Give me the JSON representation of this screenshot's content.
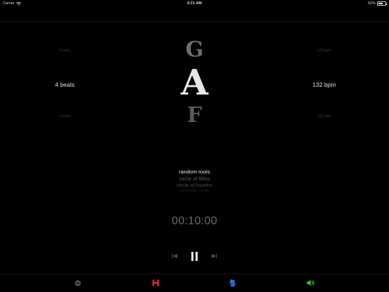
{
  "status": {
    "carrier": "Carrier",
    "time": "9:21 AM",
    "battery_percent": "62%",
    "battery_level": 0.62
  },
  "beats": {
    "above": "3 beats",
    "current": "4 beats",
    "below": "5 beats"
  },
  "tempo": {
    "above": "131 bpm",
    "current": "132 bpm",
    "below": "133 bpm"
  },
  "notes": {
    "previous": "G",
    "current": "A",
    "next": "F"
  },
  "modes": [
    "random roots",
    "circle of fifths",
    "circle of fourths",
    "chromatic scale"
  ],
  "timer": "00:10:00",
  "icons": {
    "previous": "skip-back-icon",
    "pause": "pause-icon",
    "next": "skip-forward-icon",
    "tab1": "minus-circle-icon",
    "tab2": "h-letter-icon",
    "tab3": "dice-icon",
    "tab4": "speaker-icon"
  },
  "colors": {
    "tab1": "#555555",
    "tab2": "#e8293a",
    "tab3": "#2a6fe0",
    "tab4": "#2ecc40"
  }
}
